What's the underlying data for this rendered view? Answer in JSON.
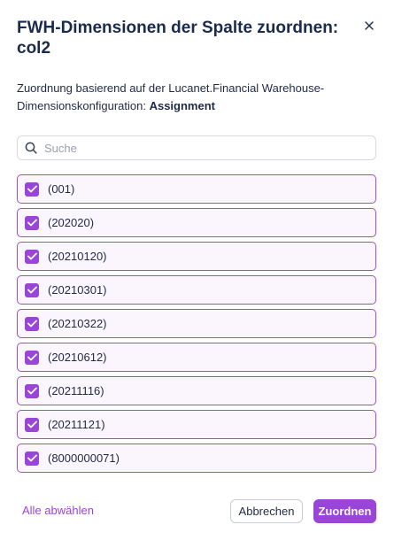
{
  "dialog": {
    "title": "FWH-Dimensionen der Spalte zuordnen: col2",
    "description_prefix": "Zuordnung basierend auf der Lucanet.Financial Warehouse-Dimensionskonfiguration: ",
    "description_bold": "Assignment"
  },
  "search": {
    "placeholder": "Suche",
    "value": ""
  },
  "items": [
    {
      "label": "(001)",
      "checked": true
    },
    {
      "label": "(202020)",
      "checked": true
    },
    {
      "label": "(20210120)",
      "checked": true
    },
    {
      "label": "(20210301)",
      "checked": true
    },
    {
      "label": "(20210322)",
      "checked": true
    },
    {
      "label": "(20210612)",
      "checked": true
    },
    {
      "label": "(20211116)",
      "checked": true
    },
    {
      "label": "(20211121)",
      "checked": true
    },
    {
      "label": "(8000000071)",
      "checked": true
    }
  ],
  "footer": {
    "deselect_all": "Alle abwählen",
    "cancel": "Abbrechen",
    "assign": "Zuordnen"
  },
  "colors": {
    "accent": "#9b44d8",
    "item_border": "#9b4fd6",
    "item_bg": "#fbf6fd"
  }
}
